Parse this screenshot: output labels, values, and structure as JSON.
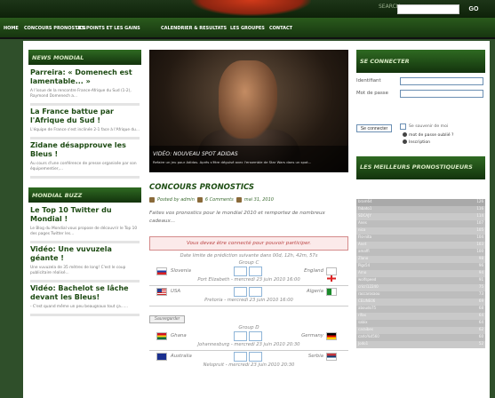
{
  "header": {
    "search_label": "SEARCH",
    "go_label": "GO"
  },
  "nav": {
    "items": [
      "HOME",
      "CONCOURS PRONOSTICS",
      "LES POINTS ET LES GAINS",
      "CALENDRIER & RESULTATS",
      "LES GROUPES",
      "CONTACT"
    ]
  },
  "news": {
    "title": "NEWS MONDIAL",
    "items": [
      {
        "headline": "Parreira: « Domenech est lamentable... »",
        "excerpt": "A l'issue de la rencontre France-Afrique du Sud (1-2), Raymond Domenech a..."
      },
      {
        "headline": "La France battue par l'Afrique du Sud !",
        "excerpt": "L'équipe de France s'est inclinée 2-1 face à l'Afrique du..."
      },
      {
        "headline": "Zidane désapprouve les Bleus !",
        "excerpt": "Au cours d'une conférence de presse organisée par son équipementier,..."
      }
    ]
  },
  "buzz": {
    "title": "MONDIAL BUZZ",
    "items": [
      {
        "headline": "Le Top 10 Twitter du Mondial !",
        "excerpt": "Le Blog du Mondial vous propose de découvrir le Top 10 des pages Twitter les..."
      },
      {
        "headline": "Vidéo: Une vuvuzela géante !",
        "excerpt": "Une vuvuzela de 35 mètres de long! C'est le coup publicitaire réalisé..."
      },
      {
        "headline": "Vidéo: Bachelot se lâche devant les Bleus!",
        "excerpt": "- C'est quand même un peu beaugnaux tout ça......"
      }
    ]
  },
  "video": {
    "title": "VIDÉO: NOUVEAU SPOT ADIDAS",
    "description": "Refaire un jeu pour Adidas. Après s'être déguisé avec l'ensemble de Star Wars dans un spot..."
  },
  "contest": {
    "title": "CONCOURS PRONOSTICS",
    "author": "Posted by admin",
    "comments": "6 Comments",
    "date": "mai 31, 2010",
    "intro": "Faites vos pronostics pour le mondial 2010 et remportez de nombreux cadeaux...",
    "alert": "Vous devez être connecté pour pouvoir participer.",
    "deadline": "Date limite de prédiction suivante dans 00d, 12h, 42m, 57s",
    "save_label": "Sauvegarder",
    "groups": [
      {
        "label": "Group C",
        "matches": [
          {
            "home": "Slovenia",
            "away": "England",
            "venue": "Port Elizabeth - mercredi 23 juin 2010 16:00"
          },
          {
            "home": "USA",
            "away": "Algeria",
            "venue": "Pretoria - mercredi 23 juin 2010 16:00"
          }
        ]
      },
      {
        "label": "Group D",
        "matches": [
          {
            "home": "Ghana",
            "away": "Germany",
            "venue": "Johannesburg - mercredi 23 juin 2010 20:30"
          },
          {
            "home": "Australia",
            "away": "Serbia",
            "venue": "Nelspruit - mercredi 23 juin 2010 20:30"
          }
        ]
      }
    ]
  },
  "login": {
    "title": "SE CONNECTER",
    "id_label": "Identifiant",
    "password_label": "Mot de passe",
    "connect_label": "Se connecter",
    "remember_label": "Se souvenir de moi",
    "forgot_label": "mot de passe oublié ?",
    "signup_label": "Inscription"
  },
  "ranking": {
    "title": "LES MEILLEURS PRONOSTIQUEURS",
    "rows": [
      {
        "name": "bram64",
        "points": "126"
      },
      {
        "name": "fabato1",
        "points": "116"
      },
      {
        "name": "SDCAJY",
        "points": "114"
      },
      {
        "name": "Anes",
        "points": "107"
      },
      {
        "name": "nico",
        "points": "105"
      },
      {
        "name": "Flo-nita",
        "points": "104"
      },
      {
        "name": "Anet",
        "points": "103"
      },
      {
        "name": "amaffi",
        "points": "100"
      },
      {
        "name": "Zlano",
        "points": "98"
      },
      {
        "name": "Pigs54",
        "points": "96"
      },
      {
        "name": "Arno",
        "points": "94"
      },
      {
        "name": "wolfspeed",
        "points": "91"
      },
      {
        "name": "cricri12240",
        "points": "75"
      },
      {
        "name": "raccarosaou",
        "points": "73"
      },
      {
        "name": "CELINE06",
        "points": "69"
      },
      {
        "name": "aboudo75",
        "points": "68"
      },
      {
        "name": "rifax",
        "points": "64"
      },
      {
        "name": "sabix",
        "points": "64"
      },
      {
        "name": "caraibes",
        "points": "62"
      },
      {
        "name": "carlo%4560",
        "points": "60"
      },
      {
        "name": "Jodo1",
        "points": "52"
      }
    ]
  },
  "colors": {
    "header_green": "#173610",
    "title_green": "#1f4f15",
    "alert_red": "#b44444"
  }
}
